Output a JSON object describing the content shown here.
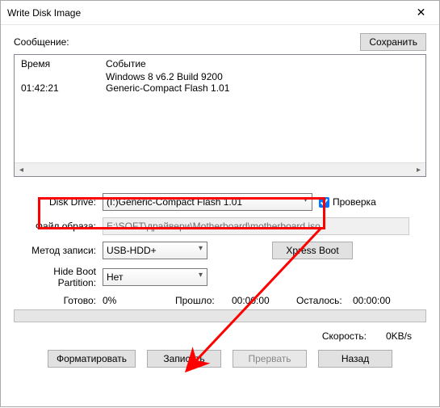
{
  "window": {
    "title": "Write Disk Image"
  },
  "message_label": "Сообщение:",
  "save_button": "Сохранить",
  "log": {
    "header_time": "Время",
    "header_event": "Событие",
    "rows": [
      {
        "time": "",
        "event": "Windows 8 v6.2 Build 9200"
      },
      {
        "time": "01:42:21",
        "event": "Generic-Compact Flash   1.01"
      }
    ]
  },
  "disk_drive": {
    "label": "Disk Drive:",
    "value": "(I:)Generic-Compact Flash   1.01"
  },
  "verify": {
    "label": "Проверка",
    "checked": true
  },
  "image_file": {
    "label": "Файл образа:",
    "value": "E:\\SOFT\\драйвери\\Motherboard\\motherboard.iso"
  },
  "write_method": {
    "label": "Метод записи:",
    "value": "USB-HDD+"
  },
  "xpress_boot": "Xpress Boot",
  "hide_boot": {
    "label": "Hide Boot Partition:",
    "value": "Нет"
  },
  "status": {
    "ready_label": "Готово:",
    "ready_value": "0%",
    "elapsed_label": "Прошло:",
    "elapsed_value": "00:00:00",
    "remain_label": "Осталось:",
    "remain_value": "00:00:00"
  },
  "speed": {
    "label": "Скорость:",
    "value": "0KB/s"
  },
  "buttons": {
    "format": "Форматировать",
    "write": "Записать",
    "abort": "Прервать",
    "back": "Назад"
  }
}
